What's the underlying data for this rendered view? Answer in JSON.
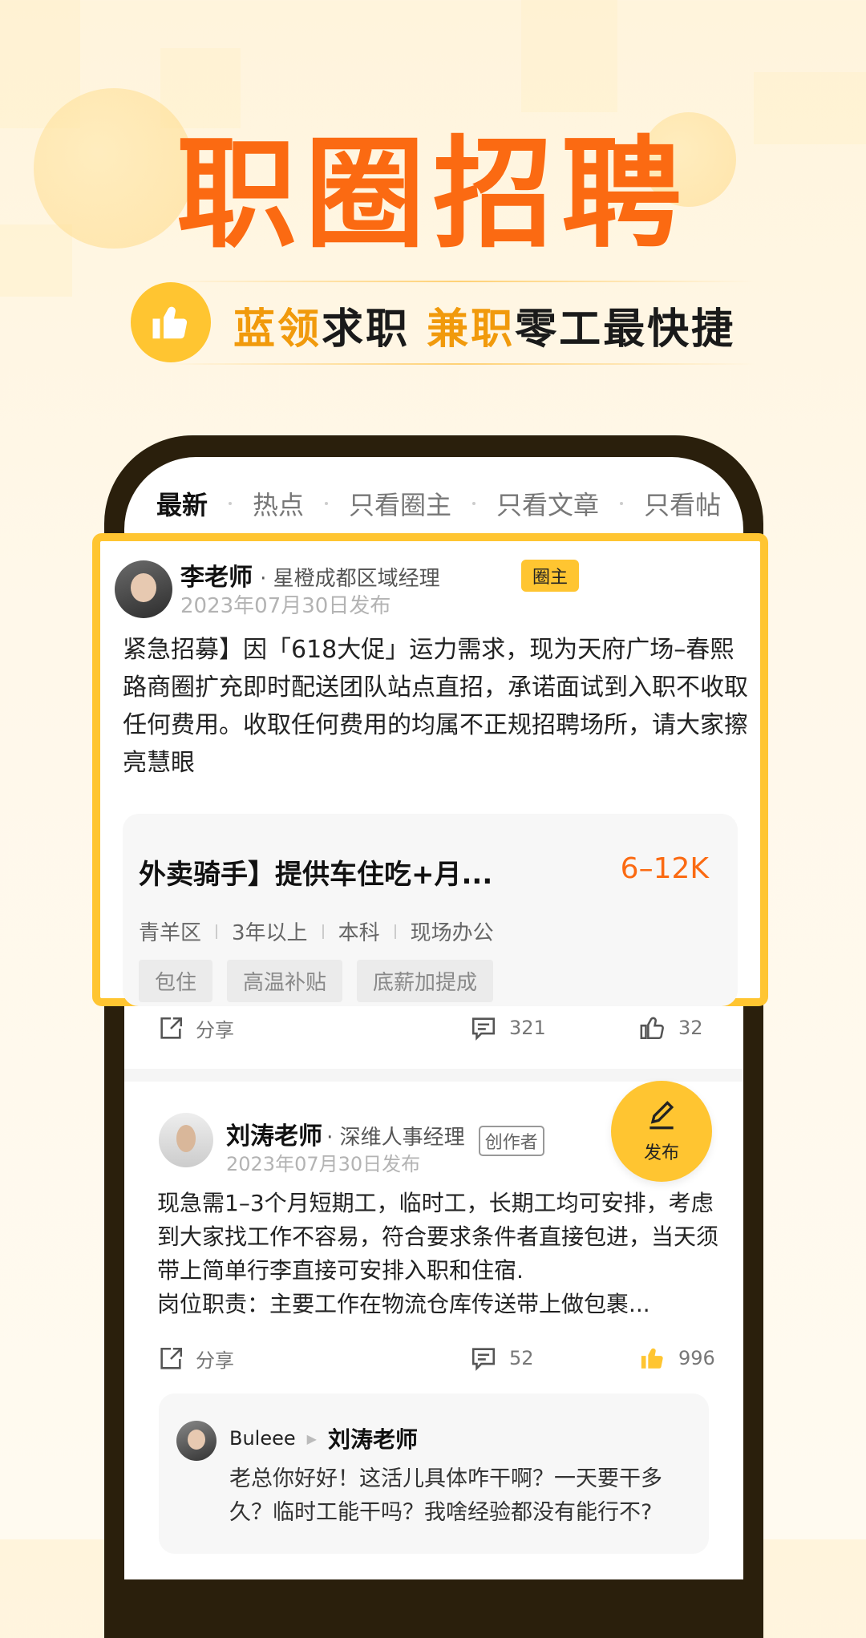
{
  "hero": {
    "title": "职圈招聘"
  },
  "subtitle": {
    "part1": "蓝领",
    "part2": "求职 ",
    "part3": "兼职",
    "part4": "零工最快捷"
  },
  "tabs": [
    {
      "label": "最新",
      "active": true
    },
    {
      "label": "热点"
    },
    {
      "label": "只看圈主"
    },
    {
      "label": "只看文章"
    },
    {
      "label": "只看帖"
    }
  ],
  "post1": {
    "author": "李老师",
    "role": "· 星橙成都区域经理",
    "badge": "圈主",
    "date": "2023年07月30日发布",
    "body": "紧急招募】因「618大促」运力需求，现为天府广场–春熙路商圈扩充即时配送团队站点直招，承诺面试到入职不收取任何费用。收取任何费用的均属不正规招聘场所，请大家擦亮慧眼",
    "job": {
      "title": "外卖骑手】提供车住吃+月...",
      "salary": "6–12K",
      "meta": [
        "青羊区",
        "3年以上",
        "本科",
        "现场办公"
      ],
      "tags": [
        "包住",
        "高温补贴",
        "底薪加提成"
      ]
    },
    "share_label": "分享",
    "comments": "321",
    "likes": "32"
  },
  "post2": {
    "author": "刘涛老师",
    "role": "· 深维人事经理",
    "badge": "创作者",
    "date": "2023年07月30日发布",
    "body": "现急需1–3个月短期工，临时工，长期工均可安排，考虑到大家找工作不容易，符合要求条件者直接包进，当天须带上简单行李直接可安排入职和住宿.\n岗位职责：主要工作在物流仓库传送带上做包裹...",
    "share_label": "分享",
    "comments": "52",
    "likes": "996"
  },
  "fab": {
    "label": "发布"
  },
  "comment": {
    "from": "Buleee",
    "to": "刘涛老师",
    "text": "老总你好好！这活儿具体咋干啊？一天要干多久？临时工能干吗？我啥经验都没有能行不?"
  },
  "colors": {
    "accent": "#fb6a12",
    "yellow": "#ffc531",
    "phone": "#2a1f0c"
  }
}
